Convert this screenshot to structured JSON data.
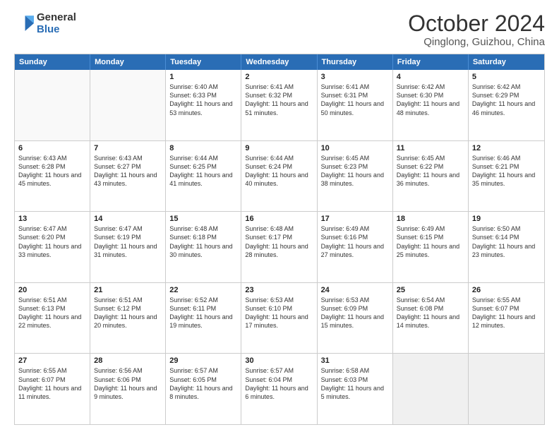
{
  "logo": {
    "line1": "General",
    "line2": "Blue"
  },
  "title": "October 2024",
  "location": "Qinglong, Guizhou, China",
  "days_of_week": [
    "Sunday",
    "Monday",
    "Tuesday",
    "Wednesday",
    "Thursday",
    "Friday",
    "Saturday"
  ],
  "weeks": [
    [
      {
        "day": "",
        "info": "",
        "empty": true
      },
      {
        "day": "",
        "info": "",
        "empty": true
      },
      {
        "day": "1",
        "info": "Sunrise: 6:40 AM\nSunset: 6:33 PM\nDaylight: 11 hours and 53 minutes."
      },
      {
        "day": "2",
        "info": "Sunrise: 6:41 AM\nSunset: 6:32 PM\nDaylight: 11 hours and 51 minutes."
      },
      {
        "day": "3",
        "info": "Sunrise: 6:41 AM\nSunset: 6:31 PM\nDaylight: 11 hours and 50 minutes."
      },
      {
        "day": "4",
        "info": "Sunrise: 6:42 AM\nSunset: 6:30 PM\nDaylight: 11 hours and 48 minutes."
      },
      {
        "day": "5",
        "info": "Sunrise: 6:42 AM\nSunset: 6:29 PM\nDaylight: 11 hours and 46 minutes."
      }
    ],
    [
      {
        "day": "6",
        "info": "Sunrise: 6:43 AM\nSunset: 6:28 PM\nDaylight: 11 hours and 45 minutes."
      },
      {
        "day": "7",
        "info": "Sunrise: 6:43 AM\nSunset: 6:27 PM\nDaylight: 11 hours and 43 minutes."
      },
      {
        "day": "8",
        "info": "Sunrise: 6:44 AM\nSunset: 6:25 PM\nDaylight: 11 hours and 41 minutes."
      },
      {
        "day": "9",
        "info": "Sunrise: 6:44 AM\nSunset: 6:24 PM\nDaylight: 11 hours and 40 minutes."
      },
      {
        "day": "10",
        "info": "Sunrise: 6:45 AM\nSunset: 6:23 PM\nDaylight: 11 hours and 38 minutes."
      },
      {
        "day": "11",
        "info": "Sunrise: 6:45 AM\nSunset: 6:22 PM\nDaylight: 11 hours and 36 minutes."
      },
      {
        "day": "12",
        "info": "Sunrise: 6:46 AM\nSunset: 6:21 PM\nDaylight: 11 hours and 35 minutes."
      }
    ],
    [
      {
        "day": "13",
        "info": "Sunrise: 6:47 AM\nSunset: 6:20 PM\nDaylight: 11 hours and 33 minutes."
      },
      {
        "day": "14",
        "info": "Sunrise: 6:47 AM\nSunset: 6:19 PM\nDaylight: 11 hours and 31 minutes."
      },
      {
        "day": "15",
        "info": "Sunrise: 6:48 AM\nSunset: 6:18 PM\nDaylight: 11 hours and 30 minutes."
      },
      {
        "day": "16",
        "info": "Sunrise: 6:48 AM\nSunset: 6:17 PM\nDaylight: 11 hours and 28 minutes."
      },
      {
        "day": "17",
        "info": "Sunrise: 6:49 AM\nSunset: 6:16 PM\nDaylight: 11 hours and 27 minutes."
      },
      {
        "day": "18",
        "info": "Sunrise: 6:49 AM\nSunset: 6:15 PM\nDaylight: 11 hours and 25 minutes."
      },
      {
        "day": "19",
        "info": "Sunrise: 6:50 AM\nSunset: 6:14 PM\nDaylight: 11 hours and 23 minutes."
      }
    ],
    [
      {
        "day": "20",
        "info": "Sunrise: 6:51 AM\nSunset: 6:13 PM\nDaylight: 11 hours and 22 minutes."
      },
      {
        "day": "21",
        "info": "Sunrise: 6:51 AM\nSunset: 6:12 PM\nDaylight: 11 hours and 20 minutes."
      },
      {
        "day": "22",
        "info": "Sunrise: 6:52 AM\nSunset: 6:11 PM\nDaylight: 11 hours and 19 minutes."
      },
      {
        "day": "23",
        "info": "Sunrise: 6:53 AM\nSunset: 6:10 PM\nDaylight: 11 hours and 17 minutes."
      },
      {
        "day": "24",
        "info": "Sunrise: 6:53 AM\nSunset: 6:09 PM\nDaylight: 11 hours and 15 minutes."
      },
      {
        "day": "25",
        "info": "Sunrise: 6:54 AM\nSunset: 6:08 PM\nDaylight: 11 hours and 14 minutes."
      },
      {
        "day": "26",
        "info": "Sunrise: 6:55 AM\nSunset: 6:07 PM\nDaylight: 11 hours and 12 minutes."
      }
    ],
    [
      {
        "day": "27",
        "info": "Sunrise: 6:55 AM\nSunset: 6:07 PM\nDaylight: 11 hours and 11 minutes."
      },
      {
        "day": "28",
        "info": "Sunrise: 6:56 AM\nSunset: 6:06 PM\nDaylight: 11 hours and 9 minutes."
      },
      {
        "day": "29",
        "info": "Sunrise: 6:57 AM\nSunset: 6:05 PM\nDaylight: 11 hours and 8 minutes."
      },
      {
        "day": "30",
        "info": "Sunrise: 6:57 AM\nSunset: 6:04 PM\nDaylight: 11 hours and 6 minutes."
      },
      {
        "day": "31",
        "info": "Sunrise: 6:58 AM\nSunset: 6:03 PM\nDaylight: 11 hours and 5 minutes."
      },
      {
        "day": "",
        "info": "",
        "empty": true,
        "shaded": true
      },
      {
        "day": "",
        "info": "",
        "empty": true,
        "shaded": true
      }
    ]
  ]
}
